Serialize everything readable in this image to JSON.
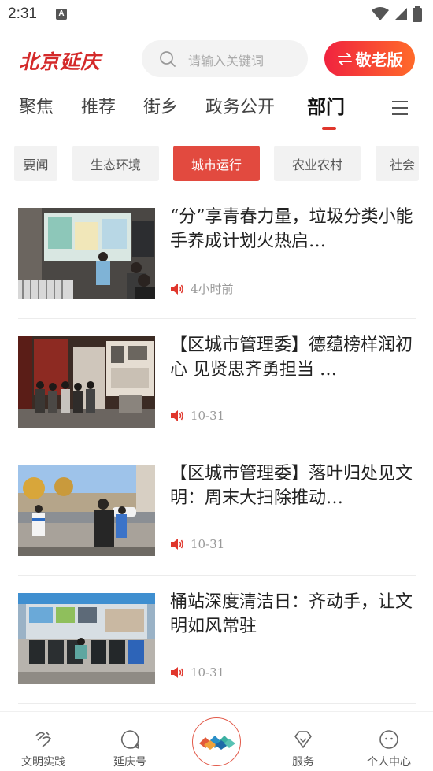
{
  "status_bar": {
    "time": "2:31",
    "a_label": "A"
  },
  "header": {
    "logo_text": "北京延庆",
    "search_placeholder": "请输入关键词",
    "elder_mode_label": "敬老版"
  },
  "channel_tabs": [
    {
      "label": "聚焦",
      "active": false
    },
    {
      "label": "推荐",
      "active": false
    },
    {
      "label": "街乡",
      "active": false
    },
    {
      "label": "政务公开",
      "active": false
    },
    {
      "label": "部门",
      "active": true
    }
  ],
  "sub_categories": [
    {
      "label": "要闻",
      "active": false
    },
    {
      "label": "生态环境",
      "active": false
    },
    {
      "label": "城市运行",
      "active": true
    },
    {
      "label": "农业农村",
      "active": false
    },
    {
      "label": "社会",
      "active": false
    }
  ],
  "news": [
    {
      "title": "“分”享青春力量，垃圾分类小能手养成计划火热启…",
      "time": "4小时前",
      "thumb": "classroom-presentation"
    },
    {
      "title": "【区城市管理委】德蕴榜样润初心 见贤思齐勇担当 …",
      "time": "10-31",
      "thumb": "exhibition-hall-visit"
    },
    {
      "title": "【区城市管理委】落叶归处见文明：周末大扫除推动…",
      "time": "10-31",
      "thumb": "street-cleanup"
    },
    {
      "title": "桶站深度清洁日：齐动手，让文明如风常驻",
      "time": "10-31",
      "thumb": "garbage-bin-station"
    }
  ],
  "bottom_nav": [
    {
      "label": "文明实践",
      "icon": "civilization-practice-icon"
    },
    {
      "label": "延庆号",
      "icon": "chat-bubble-icon"
    },
    {
      "label": "",
      "icon": "center-logo-icon"
    },
    {
      "label": "服务",
      "icon": "diamond-icon"
    },
    {
      "label": "个人中心",
      "icon": "profile-face-icon"
    }
  ],
  "colors": {
    "brand_red": "#d42a2a",
    "accent": "#e24a3f",
    "elder_gradient_start": "#f0233f",
    "elder_gradient_end": "#ff6a2a"
  }
}
